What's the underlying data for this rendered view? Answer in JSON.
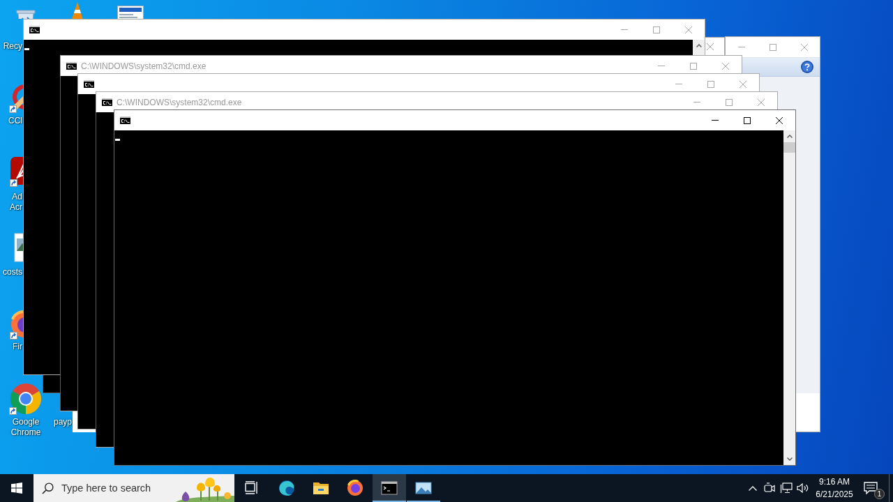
{
  "desktop": {
    "icons": [
      {
        "kind": "bin",
        "label": "Recy",
        "shortcut": false
      },
      {
        "kind": "brush",
        "label": "CCl",
        "shortcut": true
      },
      {
        "kind": "pdf",
        "label": "Ad Acr",
        "shortcut": true
      },
      {
        "kind": "picture",
        "label": "costs",
        "shortcut": false
      },
      {
        "kind": "fox",
        "label": "Fir",
        "shortcut": true
      },
      {
        "kind": "chrome",
        "label": "Google Chrome",
        "shortcut": true
      },
      {
        "kind": "cone"
      },
      {
        "kind": "document"
      },
      {
        "label": "payp"
      }
    ]
  },
  "windows": [
    {
      "kind": "dialog",
      "active": false
    },
    {
      "kind": "console",
      "active": false
    },
    {
      "kind": "console",
      "active": false
    },
    {
      "kind": "console",
      "active": false,
      "title": "C:\\WINDOWS\\system32\\cmd.exe"
    },
    {
      "kind": "console",
      "active": false
    },
    {
      "kind": "console",
      "active": false,
      "title": "C:\\WINDOWS\\system32\\cmd.exe"
    },
    {
      "kind": "console",
      "active": true
    }
  ],
  "taskbar": {
    "search": {
      "placeholder": "Type here to search"
    },
    "apps": [
      {
        "kind": "edge",
        "running": false,
        "selected": false
      },
      {
        "kind": "explorer",
        "running": false,
        "selected": false
      },
      {
        "kind": "firefox",
        "running": false,
        "selected": false
      },
      {
        "kind": "console",
        "running": true,
        "selected": true
      },
      {
        "kind": "photos",
        "running": true,
        "selected": false
      }
    ],
    "tray": {
      "time": "9:16 AM",
      "date": "6/21/2025",
      "notifications": "1"
    }
  }
}
